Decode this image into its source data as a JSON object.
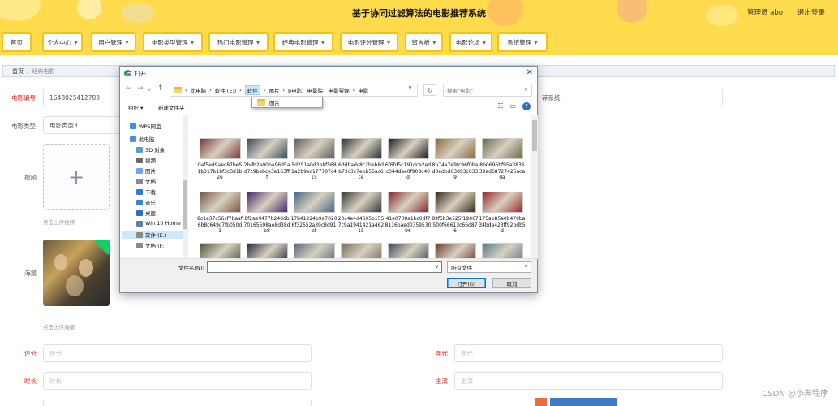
{
  "header": {
    "title": "基于协同过滤算法的电影推荐系统",
    "user_label": "管理员 abo",
    "logout_label": "退出登录"
  },
  "nav": [
    {
      "label": "首页",
      "has_caret": false
    },
    {
      "label": "个人中心",
      "has_caret": true
    },
    {
      "label": "用户管理",
      "has_caret": true
    },
    {
      "label": "电影类型管理",
      "has_caret": true
    },
    {
      "label": "热门电影管理",
      "has_caret": true
    },
    {
      "label": "经典电影管理",
      "has_caret": true
    },
    {
      "label": "电影评分管理",
      "has_caret": true
    },
    {
      "label": "留言板",
      "has_caret": true
    },
    {
      "label": "电影论坛",
      "has_caret": true
    },
    {
      "label": "系统管理",
      "has_caret": true
    }
  ],
  "breadcrumb": {
    "home": "首页",
    "separator": "/",
    "current": "经典电影"
  },
  "form": {
    "movie_id_label": "电影编号",
    "movie_id_value": "1648025412783",
    "right_top_value": "荐系统",
    "type_label": "电影类型",
    "type_value": "电影类型3",
    "video_label": "视频",
    "video_hint": "点击上传视频",
    "poster_label": "海报",
    "poster_hint": "点击上传海报",
    "rating_label": "评分",
    "rating_placeholder": "评分",
    "year_label": "年代",
    "year_placeholder": "年代",
    "duration_label": "时长",
    "duration_placeholder": "时长",
    "actor_label": "主演",
    "actor_placeholder": "主演",
    "upload_plus": "+"
  },
  "dialog": {
    "title": "打开",
    "address": [
      "此电脑",
      "软件 (E:)",
      "软件",
      "图片",
      "b电影、电影院、电影票娱",
      "电影"
    ],
    "address_sep": "›",
    "dropdown_item": "图片",
    "search_placeholder": "搜索\"电影\"",
    "organize": "组织 ▾",
    "new_folder": "新建文件夹",
    "tree": [
      {
        "label": "WPS网盘",
        "color": "#3b8ee8"
      },
      {
        "label": "此电脑",
        "color": "#4a90d9"
      },
      {
        "label": "3D 对象",
        "color": "#5a9bd5"
      },
      {
        "label": "视频",
        "color": "#6b6b6b"
      },
      {
        "label": "图片",
        "color": "#6aa9e9"
      },
      {
        "label": "文档",
        "color": "#7d8da1"
      },
      {
        "label": "下载",
        "color": "#2f7bd8"
      },
      {
        "label": "音乐",
        "color": "#3a7fd0"
      },
      {
        "label": "桌面",
        "color": "#2b6fc4"
      },
      {
        "label": "Win 10 Home",
        "color": "#5a7fa8"
      },
      {
        "label": "软件 (E:)",
        "color": "#8a8a8a",
        "selected": true
      },
      {
        "label": "文档 (F:)",
        "color": "#8a8a8a"
      }
    ],
    "files": [
      {
        "name": "0af5ed9aec87be51b317b1bf3c3d1b2e",
        "color": "#7a3a3a"
      },
      {
        "name": "2bdb2a00ba96d5ad7c9bebce3e163fff",
        "color": "#3a4a5e"
      },
      {
        "name": "5d251a0d3b8f5681a2b9ec177707c415",
        "color": "#5e5e5e"
      },
      {
        "name": "6ddbadc8c2beb8db73c3c7ebb55ac6ce",
        "color": "#2c2f3a"
      },
      {
        "name": "6f6fd5c191dce2edc344dae0f908c40d",
        "color": "#1e1e1e"
      },
      {
        "name": "8b74a7e9fc96f0bad0edbd63893c6339",
        "color": "#8a6a3a"
      },
      {
        "name": "8b0696bf95a383639ad68727425acada",
        "color": "#6a6a4a"
      },
      {
        "name": "8c1e37c56cf7baaf6b8c649c7fb050d1",
        "color": "#7a5a4a"
      },
      {
        "name": "8f2ae9477b240db70165598ae8d38db8",
        "color": "#4a2a6a"
      },
      {
        "name": "17b41224b9a70206f32552a39c8d91ef",
        "color": "#4a6a8a"
      },
      {
        "name": "20c4e4d4695b1557c9a1941421a46215",
        "color": "#3a3a3a"
      },
      {
        "name": "41e0708a1bc0df78116baed035953096",
        "color": "#8a2a2a"
      },
      {
        "name": "89f5b3e525f19067500f66613c66d876",
        "color": "#3a2a1a"
      },
      {
        "name": "175ab85a0b470ba34bda423ff92bdb5d",
        "color": "#9a2a2a"
      },
      {
        "name": "",
        "color": "#4a5a3a"
      },
      {
        "name": "",
        "color": "#2a2a3a"
      },
      {
        "name": "",
        "color": "#5a6a7a"
      },
      {
        "name": "",
        "color": "#7a6a5a"
      },
      {
        "name": "",
        "color": "#3a4a5a"
      },
      {
        "name": "",
        "color": "#6a3a2a"
      },
      {
        "name": "",
        "color": "#5a7a8a"
      }
    ],
    "filename_label": "文件名(N):",
    "filetype_value": "所有文件",
    "open_button": "打开(O)",
    "cancel_button": "取消"
  },
  "watermark": "CSDN @小奔程序",
  "colors": {
    "accent_yellow": "#ffdb4d",
    "nav_border": "#f2c311",
    "required_red": "#e02020",
    "selection_blue": "#cce8ff",
    "success_green": "#13ce66"
  }
}
